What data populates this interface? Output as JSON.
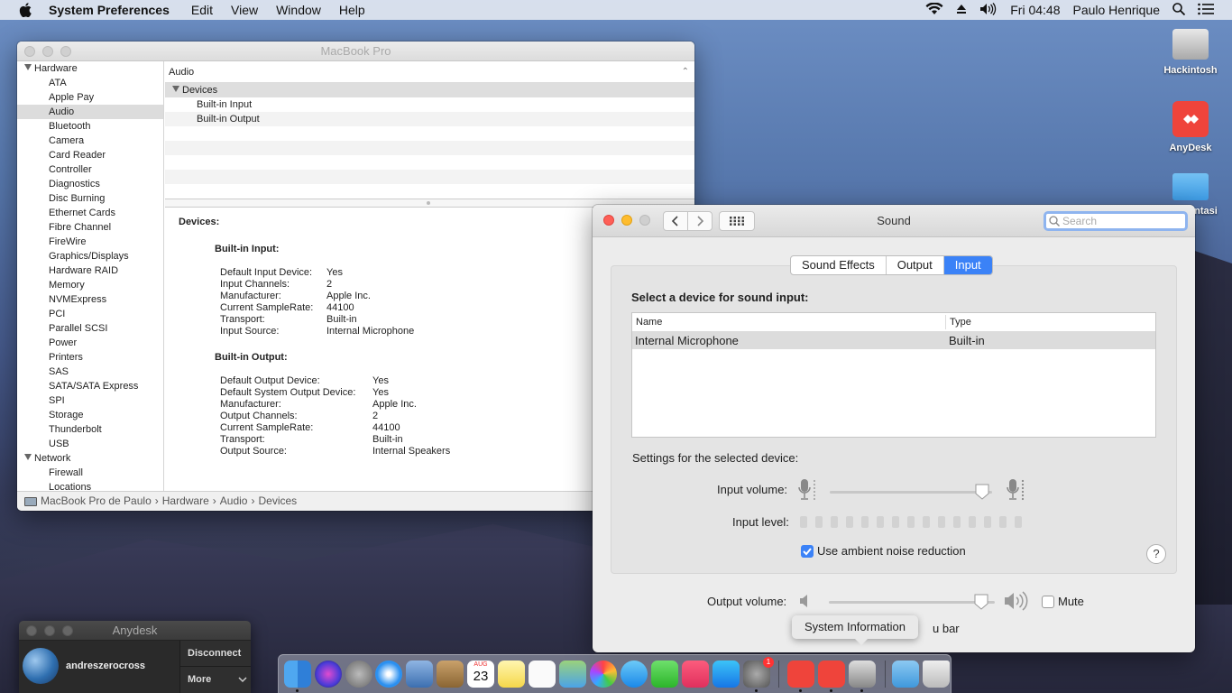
{
  "menubar": {
    "app_name": "System Preferences",
    "items": [
      "Edit",
      "View",
      "Window",
      "Help"
    ],
    "clock": "Fri 04:48",
    "user": "Paulo Henrique"
  },
  "desktop": {
    "icons": [
      "Hackintosh",
      "AnyDesk",
      "entasi"
    ]
  },
  "sysinfo": {
    "title": "MacBook Pro",
    "sidebar": {
      "hardware": "Hardware",
      "hardware_items": [
        "ATA",
        "Apple Pay",
        "Audio",
        "Bluetooth",
        "Camera",
        "Card Reader",
        "Controller",
        "Diagnostics",
        "Disc Burning",
        "Ethernet Cards",
        "Fibre Channel",
        "FireWire",
        "Graphics/Displays",
        "Hardware RAID",
        "Memory",
        "NVMExpress",
        "PCI",
        "Parallel SCSI",
        "Power",
        "Printers",
        "SAS",
        "SATA/SATA Express",
        "SPI",
        "Storage",
        "Thunderbolt",
        "USB"
      ],
      "selected": "Audio",
      "network": "Network",
      "network_items": [
        "Firewall",
        "Locations"
      ]
    },
    "list": {
      "header": "Audio",
      "group": "Devices",
      "items": [
        "Built-in Input",
        "Built-in Output"
      ]
    },
    "detail": {
      "title": "Devices:",
      "input_title": "Built-in Input:",
      "input_rows": [
        [
          "Default Input Device:",
          "Yes"
        ],
        [
          "Input Channels:",
          "2"
        ],
        [
          "Manufacturer:",
          "Apple Inc."
        ],
        [
          "Current SampleRate:",
          "44100"
        ],
        [
          "Transport:",
          "Built-in"
        ],
        [
          "Input Source:",
          "Internal Microphone"
        ]
      ],
      "output_title": "Built-in Output:",
      "output_rows": [
        [
          "Default Output Device:",
          "Yes"
        ],
        [
          "Default System Output Device:",
          "Yes"
        ],
        [
          "Manufacturer:",
          "Apple Inc."
        ],
        [
          "Output Channels:",
          "2"
        ],
        [
          "Current SampleRate:",
          "44100"
        ],
        [
          "Transport:",
          "Built-in"
        ],
        [
          "Output Source:",
          "Internal Speakers"
        ]
      ]
    },
    "path": [
      "MacBook Pro de Paulo",
      "Hardware",
      "Audio",
      "Devices"
    ]
  },
  "sound": {
    "title": "Sound",
    "search_placeholder": "Search",
    "tabs": [
      "Sound Effects",
      "Output",
      "Input"
    ],
    "active_tab": "Input",
    "select_label": "Select a device for sound input:",
    "table": {
      "col_name": "Name",
      "col_type": "Type",
      "row_name": "Internal Microphone",
      "row_type": "Built-in"
    },
    "settings_label": "Settings for the selected device:",
    "input_volume_label": "Input volume:",
    "input_volume": 0.94,
    "input_level_label": "Input level:",
    "ambient_label": "Use ambient noise reduction",
    "ambient_checked": true,
    "help": "?",
    "output_volume_label": "Output volume:",
    "output_volume": 0.92,
    "mute_label": "Mute",
    "menu_bar_partial": "u bar"
  },
  "tooltip": "System Information",
  "anydesk": {
    "title": "Anydesk",
    "user": "andreszerocross",
    "disconnect": "Disconnect",
    "more": "More"
  },
  "dock": {
    "calendar_month": "AUG",
    "calendar_day": "23",
    "prefs_badge": "1"
  }
}
